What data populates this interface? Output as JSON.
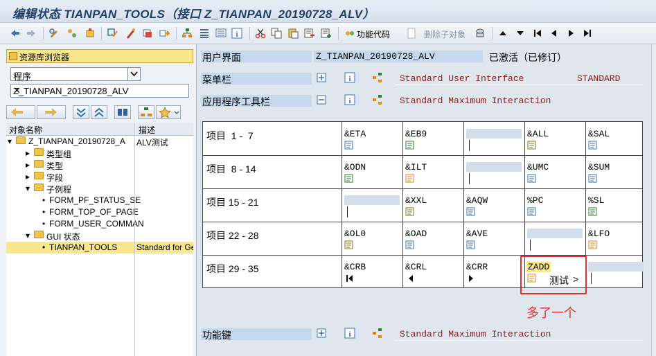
{
  "window": {
    "title": "编辑状态 TIANPAN_TOOLS（接口 Z_TIANPAN_20190728_ALV）"
  },
  "toolbar": {
    "func_code_label": "功能代码",
    "delete_sub_label": "删除子对象",
    "icons": [
      "back-icon",
      "forward-icon",
      "display-change-icon",
      "active-inactive-icon",
      "other-object-icon",
      "check-icon",
      "activate-icon",
      "where-used-icon",
      "navigate-icon",
      "hierarchy-icon",
      "list-icon",
      "display-object-list-icon",
      "info-icon",
      "cut-icon",
      "copy-icon",
      "paste-icon",
      "delete-entry-icon",
      "insert-entry-icon",
      "func-code-icon",
      "delete-sub-icon",
      "user-exit-icon",
      "up-icon",
      "down-icon",
      "first-page-icon",
      "prev-page-icon",
      "next-page-icon",
      "last-page-icon"
    ]
  },
  "left": {
    "header": "资源库浏览器",
    "object_type": "程序",
    "object_name": "Z_TIANPAN_20190728_ALV",
    "clear_symbol": "✕",
    "columns": {
      "name": "对象名称",
      "desc": "描述"
    },
    "tree": [
      {
        "label": "Z_TIANPAN_20190728_A",
        "desc": "ALV测试"
      },
      {
        "label": "类型组",
        "desc": ""
      },
      {
        "label": "类型",
        "desc": ""
      },
      {
        "label": "字段",
        "desc": ""
      },
      {
        "label": "子例程",
        "desc": ""
      },
      {
        "label": "FORM_PF_STATUS_SE",
        "desc": ""
      },
      {
        "label": "FORM_TOP_OF_PAGE",
        "desc": ""
      },
      {
        "label": "FORM_USER_COMMAN",
        "desc": ""
      },
      {
        "label": "GUI 状态",
        "desc": ""
      },
      {
        "label": "TIANPAN_TOOLS",
        "desc": "Standard for Ge"
      }
    ]
  },
  "right": {
    "user_interface": {
      "label": "用户界面",
      "value": "Z_TIANPAN_20190728_ALV",
      "status": "已激活（已修订）"
    },
    "menu_bar": {
      "label": "菜单栏",
      "text": "Standard User Interface",
      "code": "STANDARD"
    },
    "app_toolbar": {
      "label": "应用程序工具栏",
      "text": "Standard Maximum Interaction"
    },
    "rows": [
      {
        "label": "项目  1 -  7",
        "cells": [
          "&ETA",
          "&EB9",
          "",
          "&ALL",
          "&SAL"
        ]
      },
      {
        "label": "项目  8 - 14",
        "cells": [
          "&ODN",
          "&ILT",
          "",
          "&UMC",
          "&SUM"
        ]
      },
      {
        "label": "项目 15 - 21",
        "cells": [
          "",
          "&XXL",
          "&AQW",
          "%PC",
          "%SL"
        ]
      },
      {
        "label": "项目 22 - 28",
        "cells": [
          "&OL0",
          "&OAD",
          "&AVE",
          "",
          "&LFO"
        ]
      },
      {
        "label": "项目 29 - 35",
        "cells": [
          "&CRB",
          "&CRL",
          "&CRR",
          "ZADD",
          ""
        ]
      }
    ],
    "zadd_text": "测试",
    "zadd_arrow": ">",
    "annotation": "多了一个",
    "function_keys": {
      "label": "功能键",
      "text": "Standard Maximum Interaction"
    }
  },
  "colors": {
    "accent": "#1f3f66",
    "highlight": "#e03030",
    "label_bg": "#c6d8ee",
    "header_yellow": "#fbe78b"
  }
}
